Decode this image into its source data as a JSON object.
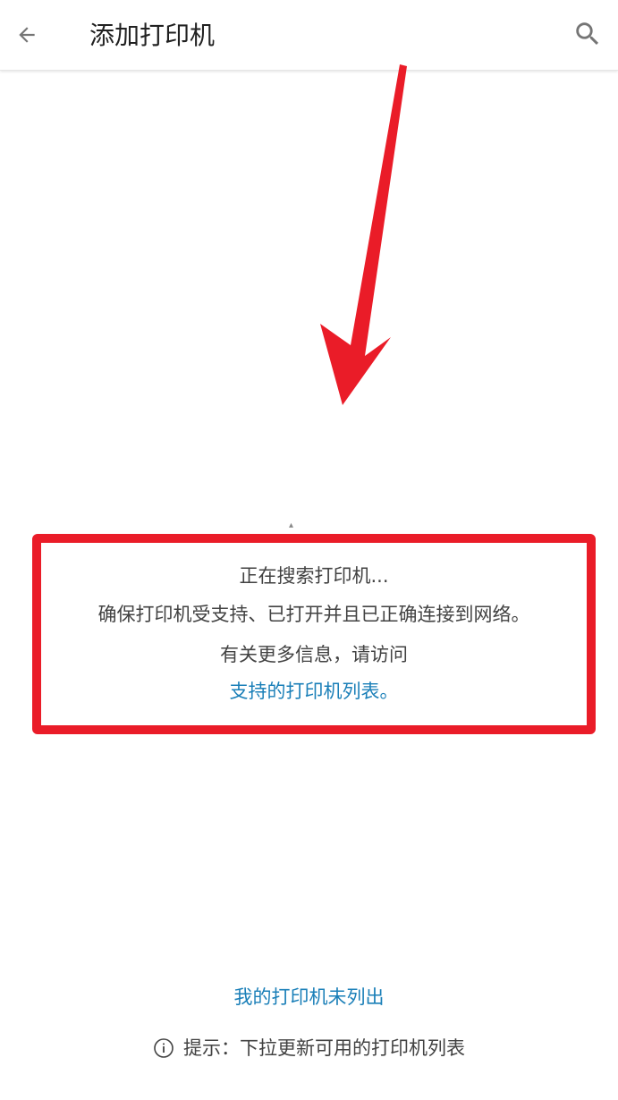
{
  "header": {
    "title": "添加打印机",
    "back_icon": "arrow-left-icon",
    "search_icon": "search-icon"
  },
  "status": {
    "searching": "正在搜索打印机...",
    "ensure": "确保打印机受支持、已打开并且已正确连接到网络。",
    "more_info": "有关更多信息，请访问",
    "supported_link": "支持的打印机列表。"
  },
  "footer": {
    "not_listed_link": "我的打印机未列出",
    "hint": "提示：下拉更新可用的打印机列表",
    "hint_icon": "info-icon"
  },
  "colors": {
    "annotation_red": "#ea1c28",
    "link_blue": "#1a7fb8",
    "text_gray": "#424242"
  }
}
